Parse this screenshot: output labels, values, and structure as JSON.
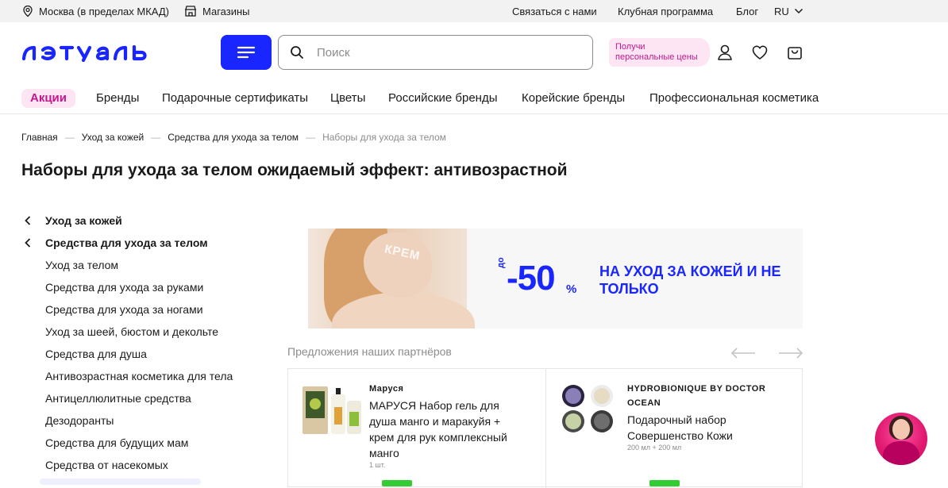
{
  "topbar": {
    "location": "Москва (в пределах МКАД)",
    "stores": "Магазины",
    "contact": "Связаться с нами",
    "club": "Клубная программа",
    "blog": "Блог",
    "lang": "RU"
  },
  "header": {
    "logo_text": "лэтуаль",
    "search_placeholder": "Поиск",
    "promo_badge": "Получи персональные цены"
  },
  "nav": {
    "items": [
      "Акции",
      "Бренды",
      "Подарочные сертификаты",
      "Цветы",
      "Российские бренды",
      "Корейские бренды",
      "Профессиональная косметика"
    ]
  },
  "breadcrumb": {
    "items": [
      "Главная",
      "Уход за кожей",
      "Средства для ухода за телом",
      "Наборы для ухода за телом"
    ],
    "separator": "—"
  },
  "page_title": "Наборы для ухода за телом ожидаемый эффект: антивозрастной",
  "sidebar": {
    "parents": [
      "Уход за кожей",
      "Средства для ухода за телом"
    ],
    "children": [
      "Уход за телом",
      "Средства для ухода за руками",
      "Средства для ухода за ногами",
      "Уход за шеей, бюстом и декольте",
      "Средства для душа",
      "Антивозрастная косметика для тела",
      "Антицеллюлитные средства",
      "Дезодоранты",
      "Средства для будущих мам",
      "Средства от насекомых"
    ]
  },
  "banner": {
    "krem": "КРЕМ",
    "prefix": "до",
    "discount": "-50",
    "percent": "%",
    "slogan": "НА УХОД ЗА КОЖЕЙ И НЕ ТОЛЬКО"
  },
  "partners": {
    "title": "Предложения наших партнёров",
    "cards": [
      {
        "brand": "Маруся",
        "name": "МАРУСЯ Набор гель для душа манго и маракуйя + крем для рук комплексный манго",
        "meta": "1 шт."
      },
      {
        "brand": "HYDROBIONIQUE BY DOCTOR OCEAN",
        "name": "Подарочный набор Совершенство Кожи",
        "meta": "200 мл + 200 мл"
      }
    ]
  },
  "colors": {
    "brand_blue": "#1a26ff",
    "accent_pink": "#c4198c",
    "pink_bg": "#fde5f3"
  }
}
